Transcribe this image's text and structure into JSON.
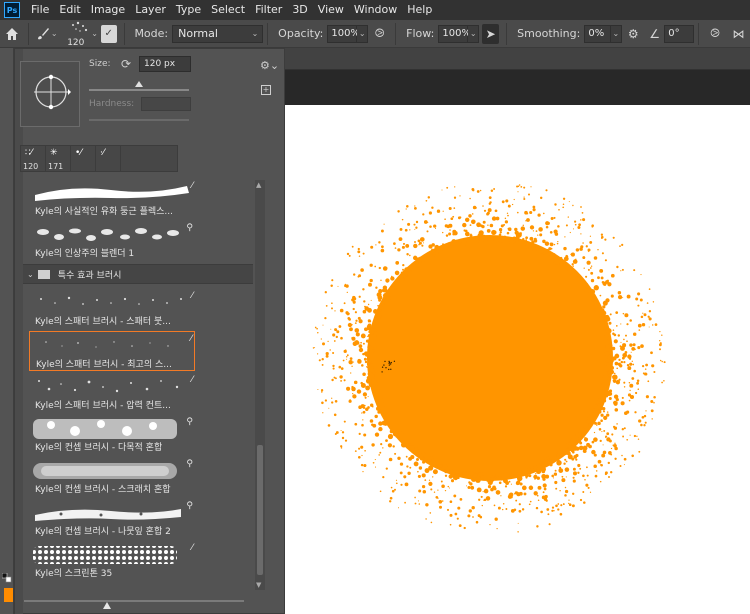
{
  "menubar": {
    "app_logo": "Ps",
    "items": [
      "File",
      "Edit",
      "Image",
      "Layer",
      "Type",
      "Select",
      "Filter",
      "3D",
      "View",
      "Window",
      "Help"
    ]
  },
  "options": {
    "brush_size": "120",
    "mode_label": "Mode:",
    "mode_value": "Normal",
    "opacity_label": "Opacity:",
    "opacity_value": "100%",
    "flow_label": "Flow:",
    "flow_value": "100%",
    "smoothing_label": "Smoothing:",
    "smoothing_value": "0%",
    "angle_value": "0°"
  },
  "brush_panel": {
    "size_label": "Size:",
    "size_value": "120 px",
    "size_fraction": 0.5,
    "hardness_label": "Hardness:",
    "recent": [
      {
        "size": "120"
      },
      {
        "size": "171"
      },
      {
        "size": ""
      },
      {
        "size": ""
      }
    ],
    "items": [
      {
        "name": "Kyle의 사실적인 유화 둥근 플렉스...",
        "selected": false
      },
      {
        "name": "Kyle의 인상주의 블렌더 1",
        "selected": false
      },
      {
        "name": "Kyle의 스패터 브러시 - 스패터 붓...",
        "selected": false
      },
      {
        "name": "Kyle의 스패터 브러시 - 최고의 스...",
        "selected": true
      },
      {
        "name": "Kyle의 스패터 브러시 - 압력 컨트...",
        "selected": false
      },
      {
        "name": "Kyle의 컨셉 브러시 - 다목적 혼합",
        "selected": false
      },
      {
        "name": "Kyle의 컨셉 브러시 - 스크래치 혼합",
        "selected": false
      },
      {
        "name": "Kyle의 컨셉 브러시 - 나뭇잎 혼합 2",
        "selected": false
      },
      {
        "name": "Kyle의 스크린톤 35",
        "selected": false
      }
    ],
    "group_name": "특수 효과 브러시"
  },
  "colors": {
    "paint": "#ff9500",
    "selection": "#f27a26"
  }
}
